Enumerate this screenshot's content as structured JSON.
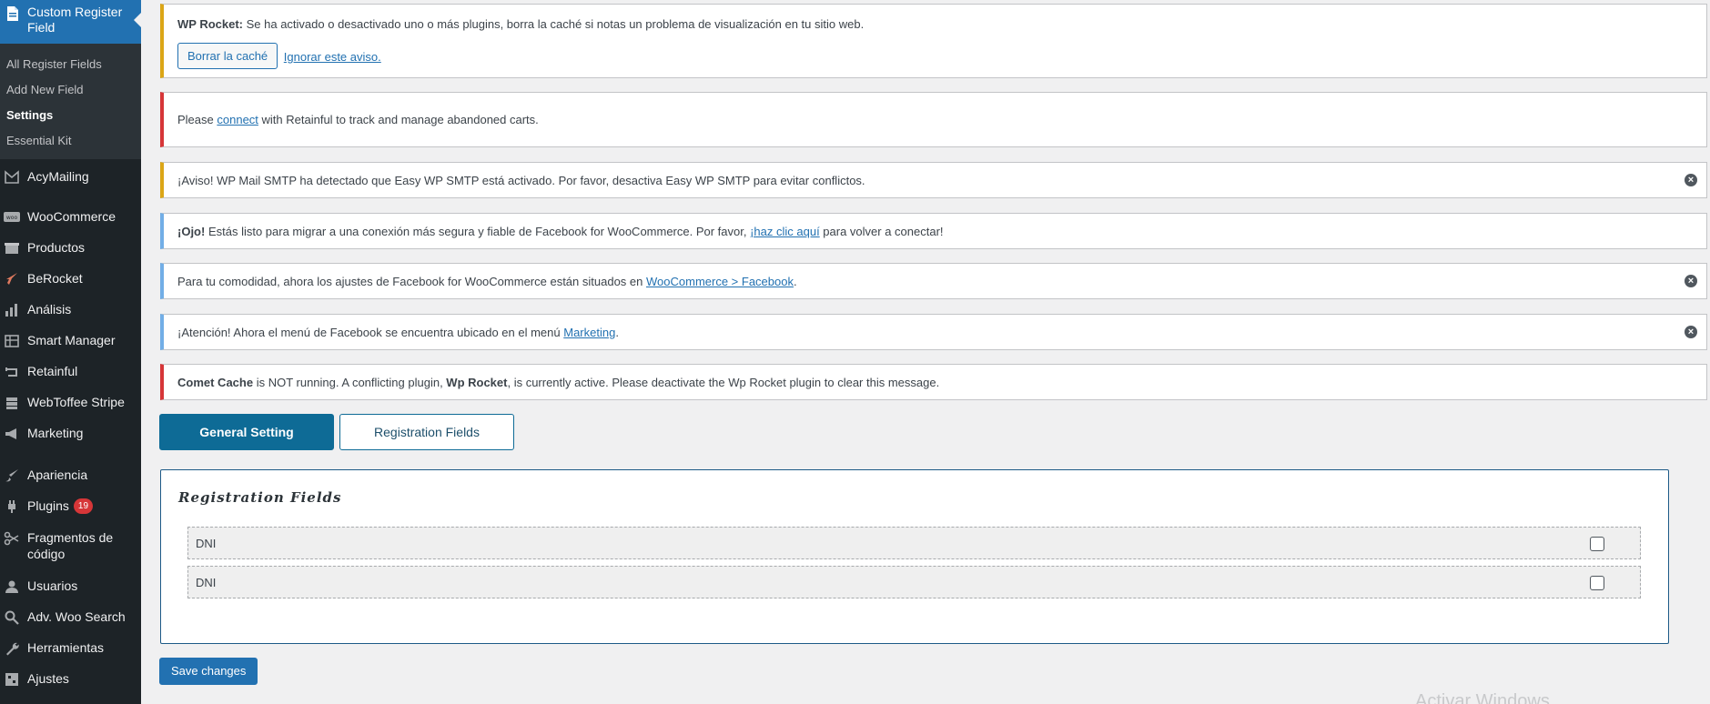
{
  "sidebar": {
    "current": {
      "label": "Custom Register Field",
      "icon": "page-icon"
    },
    "submenu": [
      {
        "label": "All Register Fields",
        "active": false
      },
      {
        "label": "Add New Field",
        "active": false
      },
      {
        "label": "Settings",
        "active": true
      },
      {
        "label": "Essential Kit",
        "active": false
      }
    ],
    "items": [
      {
        "label": "AcyMailing",
        "icon": "acymailing-icon"
      },
      {
        "label": "WooCommerce",
        "icon": "woocommerce-icon"
      },
      {
        "label": "Productos",
        "icon": "box-icon"
      },
      {
        "label": "BeRocket",
        "icon": "rocket-icon"
      },
      {
        "label": "Análisis",
        "icon": "bar-chart-icon"
      },
      {
        "label": "Smart Manager",
        "icon": "grid-icon"
      },
      {
        "label": "Retainful",
        "icon": "loop-icon"
      },
      {
        "label": "WebToffee Stripe",
        "icon": "stack-icon"
      },
      {
        "label": "Marketing",
        "icon": "megaphone-icon"
      },
      {
        "label": "Apariencia",
        "icon": "brush-icon"
      },
      {
        "label": "Plugins",
        "icon": "plug-icon",
        "badge": "19"
      },
      {
        "label": "Fragmentos de código",
        "icon": "scissors-icon"
      },
      {
        "label": "Usuarios",
        "icon": "user-icon"
      },
      {
        "label": "Adv. Woo Search",
        "icon": "search-icon"
      },
      {
        "label": "Herramientas",
        "icon": "wrench-icon"
      },
      {
        "label": "Ajustes",
        "icon": "sliders-icon"
      }
    ]
  },
  "notices": {
    "wp_rocket": {
      "strong": "WP Rocket:",
      "text": " Se ha activado o desactivado uno o más plugins, borra la caché si notas un problema de visualización en tu sitio web.",
      "button": "Borrar la caché",
      "link": "Ignorar este aviso."
    },
    "retainful": {
      "before": "Please ",
      "link": "connect",
      "after": " with Retainful to track and manage abandoned carts."
    },
    "smtp": {
      "text": "¡Aviso! WP Mail SMTP ha detectado que Easy WP SMTP está activado. Por favor, desactiva Easy WP SMTP para evitar conflictos."
    },
    "facebook_migrate": {
      "strong": "¡Ojo!",
      "before": " Estás listo para migrar a una conexión más segura y fiable de Facebook for WooCommerce. Por favor, ",
      "link": "¡haz clic aquí",
      "after": " para volver a conectar!"
    },
    "facebook_settings": {
      "before": "Para tu comodidad, ahora los ajustes de Facebook for WooCommerce están situados en ",
      "link": "WooCommerce > Facebook",
      "after": "."
    },
    "facebook_menu": {
      "before": "¡Atención! Ahora el menú de Facebook se encuentra ubicado en el menú ",
      "link": "Marketing",
      "after": "."
    },
    "comet_cache": {
      "strong1": "Comet Cache",
      "middle1": " is NOT running. A conflicting plugin, ",
      "strong2": "Wp Rocket",
      "after": ", is currently active. Please deactivate the Wp Rocket plugin to clear this message."
    }
  },
  "tabs": {
    "general": "General Setting",
    "registration": "Registration Fields"
  },
  "panel": {
    "title": "Registration Fields",
    "rows": [
      {
        "name": "DNI",
        "checked": false
      },
      {
        "name": "DNI",
        "checked": false
      }
    ]
  },
  "save_label": "Save changes",
  "watermark": "Activar Windows",
  "colors": {
    "sidebar_bg": "#1d2327",
    "accent": "#2271b1",
    "tab_primary": "#0e6b96",
    "badge": "#d63638"
  }
}
